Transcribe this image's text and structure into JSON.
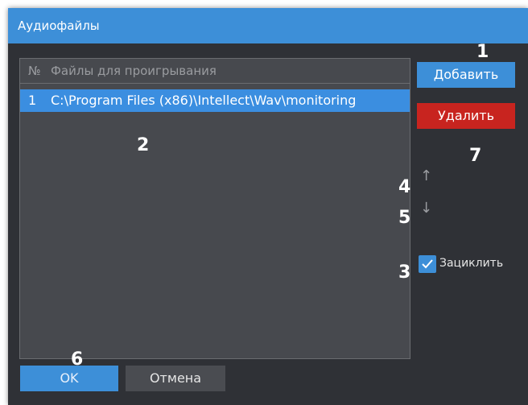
{
  "window": {
    "title": "Аудиофайлы"
  },
  "list": {
    "header_num": "№",
    "header_files": "Файлы для проигрывания",
    "rows": [
      {
        "num": "1",
        "path": "C:\\Program Files (x86)\\Intellect\\Wav\\monitoring"
      }
    ]
  },
  "buttons": {
    "add": "Добавить",
    "delete": "Удалить",
    "ok": "OK",
    "cancel": "Отмена"
  },
  "arrows": {
    "up": "↑",
    "down": "↓"
  },
  "loop": {
    "label": "Зациклить",
    "checked": true
  },
  "callouts": [
    "1",
    "2",
    "3",
    "4",
    "5",
    "6",
    "7"
  ],
  "colors": {
    "accent": "#3d8fd8",
    "delete": "#c8241f",
    "selection": "#3b8ee0",
    "background": "#2f3136"
  }
}
